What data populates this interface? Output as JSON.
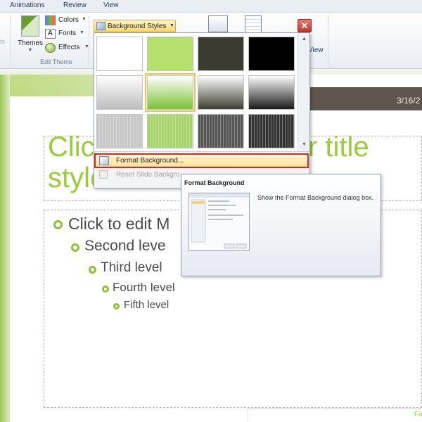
{
  "menu": {
    "tabs": [
      "Animations",
      "Review",
      "View"
    ]
  },
  "ribbon": {
    "themes_label": "Themes",
    "colors_label": "Colors",
    "fonts_label": "Fonts",
    "effects_label": "Effects",
    "group_label": "Edit Theme",
    "background_styles_label": "Background Styles",
    "right_partial_label": "View",
    "left_partial_label": "ts"
  },
  "gallery": {
    "swatches": [
      {
        "name": "style-1",
        "color": "#ffffff"
      },
      {
        "name": "style-2",
        "color": "#b5e06b"
      },
      {
        "name": "style-3",
        "color": "#3b3b31"
      },
      {
        "name": "style-4",
        "color": "#000000"
      },
      {
        "name": "style-5",
        "color": "#bdbdbd"
      },
      {
        "name": "style-6",
        "color": "#7cc234"
      },
      {
        "name": "style-7",
        "color": "#3e3e33"
      },
      {
        "name": "style-8",
        "color": "#1a1a1a"
      },
      {
        "name": "style-9",
        "color": "#c7c7c7"
      },
      {
        "name": "style-10",
        "color": "#a6d36a"
      },
      {
        "name": "style-11",
        "color": "#555555"
      },
      {
        "name": "style-12",
        "color": "#333333"
      }
    ],
    "selected_index": 5,
    "menu_items": [
      "Format Background...",
      "Reset Slide Backgro"
    ]
  },
  "tooltip": {
    "title": "Format Background",
    "description": "Show the Format Background dialog box."
  },
  "slide": {
    "date": "3/16/2",
    "title_left": "Clic\nstyle",
    "title_right": "r title",
    "levels": [
      "Click to edit M",
      "Second leve",
      "Third level",
      "Fourth level",
      "Fifth level"
    ],
    "footer_partial": "Fo"
  },
  "colors": {
    "accent": "#9acc3a",
    "highlight_border": "#d22a2a",
    "gallery_button": "#fbd66a"
  }
}
